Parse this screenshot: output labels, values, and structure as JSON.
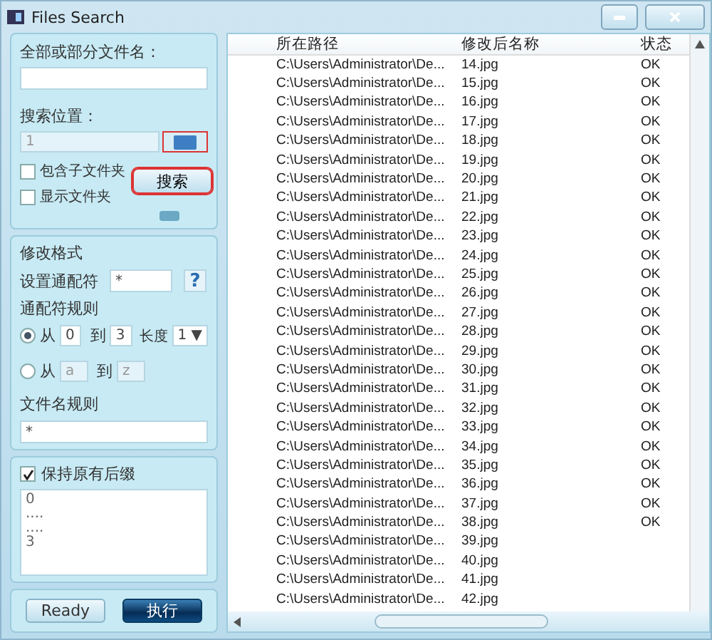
{
  "window": {
    "title": "Files Search"
  },
  "search_panel": {
    "name_label": "全部或部分文件名：",
    "location_label": "搜索位置：",
    "location_value": "1",
    "folder_button_highlighted": true,
    "options": [
      {
        "label": "包含子文件夹",
        "checked": false
      },
      {
        "label": "显示文件夹",
        "checked": false
      }
    ],
    "search_button": {
      "label": "搜索",
      "highlighted": true
    }
  },
  "format_panel": {
    "title": "修改格式",
    "wildcard_label": "设置通配符",
    "wildcard_value": "*",
    "help_button": "?",
    "rules_title": "通配符规则",
    "rules": [
      {
        "selected": true,
        "from_label": "从",
        "from_value": "0",
        "to_label": "到",
        "to_value": "3",
        "length_label": "长度",
        "length_value": "1 ▼"
      },
      {
        "selected": false,
        "from_label": "从",
        "from_value": "a",
        "to_label": "到",
        "to_value": "z"
      }
    ],
    "filename_rule_label": "文件名规则",
    "filename_rule_value": "*"
  },
  "suffix_panel": {
    "label": "保持原有后缀",
    "checked": true,
    "preview_lines": [
      "0",
      "....",
      "....",
      "3"
    ]
  },
  "buttons": [
    {
      "label": "Ready",
      "kind": "plain"
    },
    {
      "label": "执行",
      "kind": "primary"
    }
  ],
  "table": {
    "columns": [
      "所在路径",
      "修改后名称",
      "状态"
    ],
    "rows": [
      {
        "path": "C:\\Users\\Administrator\\De...",
        "name": "14.jpg",
        "status": "OK"
      },
      {
        "path": "C:\\Users\\Administrator\\De...",
        "name": "15.jpg",
        "status": "OK"
      },
      {
        "path": "C:\\Users\\Administrator\\De...",
        "name": "16.jpg",
        "status": "OK"
      },
      {
        "path": "C:\\Users\\Administrator\\De...",
        "name": "17.jpg",
        "status": "OK"
      },
      {
        "path": "C:\\Users\\Administrator\\De...",
        "name": "18.jpg",
        "status": "OK"
      },
      {
        "path": "C:\\Users\\Administrator\\De...",
        "name": "19.jpg",
        "status": "OK"
      },
      {
        "path": "C:\\Users\\Administrator\\De...",
        "name": "20.jpg",
        "status": "OK"
      },
      {
        "path": "C:\\Users\\Administrator\\De...",
        "name": "21.jpg",
        "status": "OK"
      },
      {
        "path": "C:\\Users\\Administrator\\De...",
        "name": "22.jpg",
        "status": "OK"
      },
      {
        "path": "C:\\Users\\Administrator\\De...",
        "name": "23.jpg",
        "status": "OK"
      },
      {
        "path": "C:\\Users\\Administrator\\De...",
        "name": "24.jpg",
        "status": "OK"
      },
      {
        "path": "C:\\Users\\Administrator\\De...",
        "name": "25.jpg",
        "status": "OK"
      },
      {
        "path": "C:\\Users\\Administrator\\De...",
        "name": "26.jpg",
        "status": "OK"
      },
      {
        "path": "C:\\Users\\Administrator\\De...",
        "name": "27.jpg",
        "status": "OK"
      },
      {
        "path": "C:\\Users\\Administrator\\De...",
        "name": "28.jpg",
        "status": "OK"
      },
      {
        "path": "C:\\Users\\Administrator\\De...",
        "name": "29.jpg",
        "status": "OK"
      },
      {
        "path": "C:\\Users\\Administrator\\De...",
        "name": "30.jpg",
        "status": "OK"
      },
      {
        "path": "C:\\Users\\Administrator\\De...",
        "name": "31.jpg",
        "status": "OK"
      },
      {
        "path": "C:\\Users\\Administrator\\De...",
        "name": "32.jpg",
        "status": "OK"
      },
      {
        "path": "C:\\Users\\Administrator\\De...",
        "name": "33.jpg",
        "status": "OK"
      },
      {
        "path": "C:\\Users\\Administrator\\De...",
        "name": "34.jpg",
        "status": "OK"
      },
      {
        "path": "C:\\Users\\Administrator\\De...",
        "name": "35.jpg",
        "status": "OK"
      },
      {
        "path": "C:\\Users\\Administrator\\De...",
        "name": "36.jpg",
        "status": "OK"
      },
      {
        "path": "C:\\Users\\Administrator\\De...",
        "name": "37.jpg",
        "status": "OK"
      },
      {
        "path": "C:\\Users\\Administrator\\De...",
        "name": "38.jpg",
        "status": "OK"
      },
      {
        "path": "C:\\Users\\Administrator\\De...",
        "name": "39.jpg"
      },
      {
        "path": "C:\\Users\\Administrator\\De...",
        "name": "40.jpg"
      },
      {
        "path": "C:\\Users\\Administrator\\De...",
        "name": "41.jpg"
      },
      {
        "path": "C:\\Users\\Administrator\\De...",
        "name": "42.jpg"
      }
    ]
  }
}
